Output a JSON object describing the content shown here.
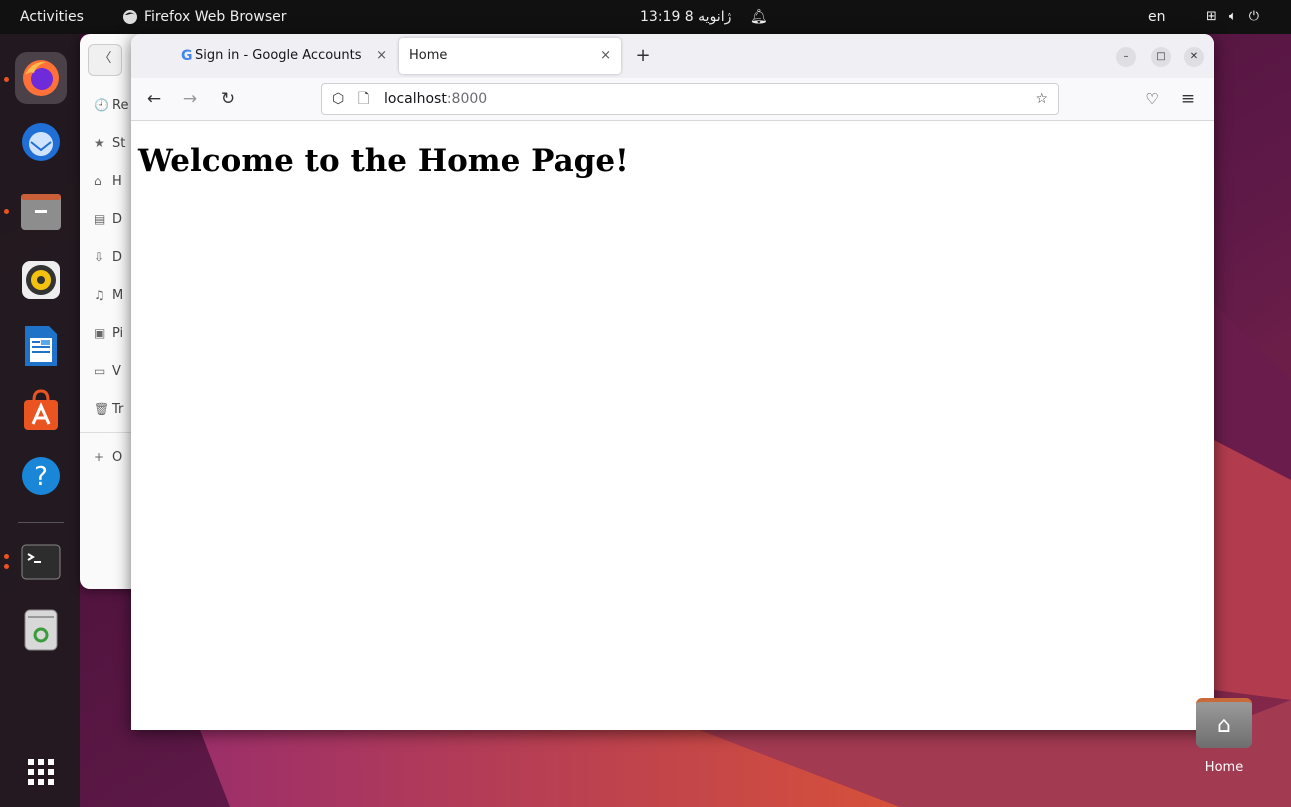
{
  "topbar": {
    "activities": "Activities",
    "app_name": "Firefox Web Browser",
    "clock": "13:19 ژانویه 8",
    "language": "en"
  },
  "dock": {
    "apps": [
      "firefox-icon",
      "thunderbird-icon",
      "files-icon",
      "rhythmbox-icon",
      "writer-icon",
      "app-center-icon",
      "help-icon",
      "terminal-icon",
      "trash-icon",
      "show-apps-icon"
    ]
  },
  "files": {
    "back_label": "〈",
    "items": [
      {
        "icon": "🕘",
        "label": "Re"
      },
      {
        "icon": "★",
        "label": "St"
      },
      {
        "icon": "⌂",
        "label": "H"
      },
      {
        "icon": "▤",
        "label": "D"
      },
      {
        "icon": "⇩",
        "label": "D"
      },
      {
        "icon": "♫",
        "label": "M"
      },
      {
        "icon": "▣",
        "label": "Pi"
      },
      {
        "icon": "▭",
        "label": "V"
      },
      {
        "icon": "🗑",
        "label": "Tr"
      }
    ],
    "other": {
      "icon": "+",
      "label": "O"
    }
  },
  "browser": {
    "tabs": [
      {
        "title": "Sign in - Google Accounts",
        "icon": "G",
        "close": "×"
      },
      {
        "title": "Home",
        "close": "×"
      }
    ],
    "new_tab": "+",
    "url_host": "localhost",
    "url_port": ":8000",
    "page_heading": "Welcome to the Home Page!"
  },
  "desktop": {
    "home_label": "Home"
  },
  "colors": {
    "accent": "#e95420",
    "wallpaper_dark": "#2c001e",
    "wallpaper_purple": "#77216f"
  }
}
